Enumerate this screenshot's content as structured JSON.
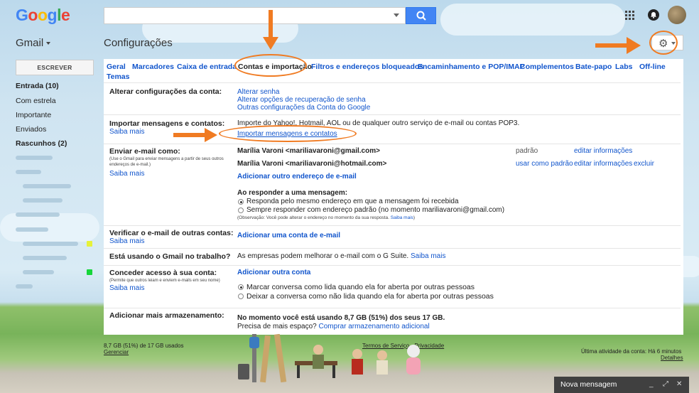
{
  "header": {
    "logo": "Google",
    "search": {
      "value": "",
      "placeholder": ""
    },
    "icons": [
      "search-icon",
      "apps-grid-icon",
      "notifications-icon",
      "avatar"
    ]
  },
  "app": {
    "name": "Gmail",
    "page_title": "Configurações"
  },
  "sidebar": {
    "compose_label": "ESCREVER",
    "items": [
      {
        "label": "Entrada (10)",
        "bold": true
      },
      {
        "label": "Com estrela",
        "bold": false
      },
      {
        "label": "Importante",
        "bold": false
      },
      {
        "label": "Enviados",
        "bold": false
      },
      {
        "label": "Rascunhos (2)",
        "bold": true
      }
    ]
  },
  "tabs": [
    "Geral",
    "Marcadores",
    "Caixa de entrada",
    "Contas e importação",
    "Filtros e endereços bloqueados",
    "Encaminhamento e POP/IMAP",
    "Complementos",
    "Bate-papo",
    "Labs",
    "Off-line",
    "Temas"
  ],
  "selected_tab": "Contas e importação",
  "sections": {
    "alterar": {
      "label": "Alterar configurações da conta:",
      "links": [
        "Alterar senha",
        "Alterar opções de recuperação de senha",
        "Outras configurações da Conta do Google"
      ]
    },
    "importar": {
      "label": "Importar mensagens e contatos:",
      "saiba": "Saiba mais",
      "text": "Importe do Yahoo!, Hotmail, AOL ou de qualquer outro serviço de e-mail ou contas POP3.",
      "link": "Importar mensagens e contatos"
    },
    "enviar": {
      "label": "Enviar e-mail como:",
      "note": "(Use o Gmail para enviar mensagens a partir de seus outros endereços de e-mail.)",
      "saiba": "Saiba mais",
      "addresses": [
        {
          "address": "Marília Varoni <mariliavaroni@gmail.com>",
          "status": "padrão",
          "edit": "editar informações",
          "delete": ""
        },
        {
          "address": "Marília Varoni <mariliavaroni@hotmail.com>",
          "status": "usar como padrão",
          "edit": "editar informações",
          "delete": "excluir"
        }
      ],
      "add_link": "Adicionar outro endereço de e-mail",
      "reply_heading": "Ao responder a uma mensagem:",
      "reply_options": [
        {
          "label": "Responda pelo mesmo endereço em que a mensagem foi recebida",
          "checked": true
        },
        {
          "label": "Sempre responder com endereço padrão (no momento mariliavaroni@gmail.com)",
          "checked": false
        }
      ],
      "reply_note": "(Observação: Você pode alterar o endereço no momento da sua resposta.",
      "reply_note_link": "Saiba mais",
      "reply_note_end": ")"
    },
    "verificar": {
      "label": "Verificar o e-mail de outras contas:",
      "saiba": "Saiba mais",
      "link": "Adicionar uma conta de e-mail"
    },
    "trabalho": {
      "label": "Está usando o Gmail no trabalho?",
      "text": "As empresas podem melhorar o e-mail com o G Suite.",
      "link": "Saiba mais"
    },
    "conceder": {
      "label": "Conceder acesso à sua conta:",
      "note": "(Permite que outros leiam e enviem e-mails em seu nome)",
      "saiba": "Saiba mais",
      "link": "Adicionar outra conta",
      "options": [
        {
          "label": "Marcar conversa como lida quando ela for aberta por outras pessoas",
          "checked": true
        },
        {
          "label": "Deixar a conversa como não lida quando ela for aberta por outras pessoas",
          "checked": false
        }
      ]
    },
    "armazenamento": {
      "label": "Adicionar mais armazenamento:",
      "text": "No momento você está usando 8,7 GB (51%) dos seus 17 GB.",
      "question": "Precisa de mais espaço?",
      "link": "Comprar armazenamento adicional"
    }
  },
  "footer": {
    "usage": "8,7 GB (51%) de 17 GB usados",
    "manage": "Gerenciar",
    "terms": "Termos de Serviço",
    "sep": " - ",
    "privacy": "Privacidade",
    "activity": "Última atividade da conta: Há 6 minutos",
    "details": "Detalhes"
  },
  "compose_bar": {
    "title": "Nova mensagem"
  },
  "colors": {
    "accent": "#4285f4",
    "link": "#1155cc",
    "annotation": "#f07b22"
  }
}
